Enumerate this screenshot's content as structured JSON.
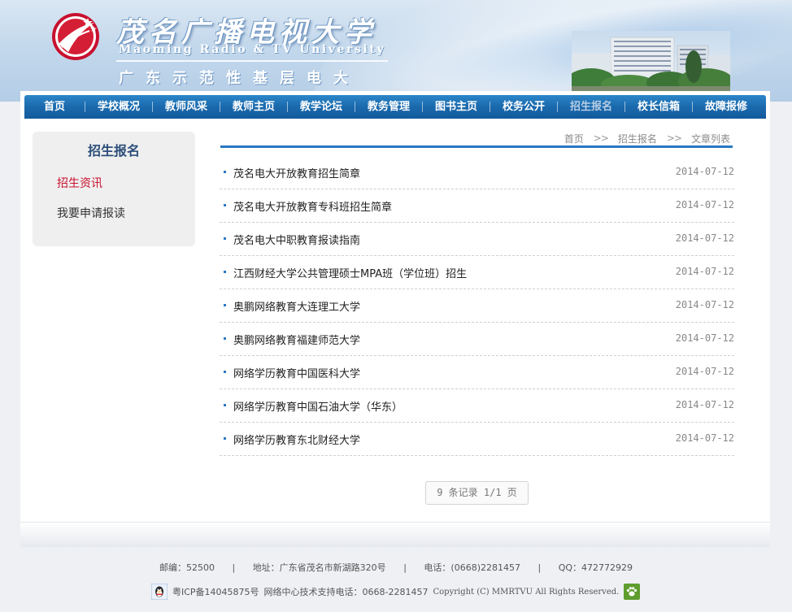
{
  "header": {
    "title_cn": "茂名广播电视大学",
    "title_en": "Maoming Radio & TV University",
    "slogan": "广东示范性基层电大"
  },
  "nav": {
    "items": [
      {
        "label": "首页",
        "width": 74
      },
      {
        "label": "学校概况",
        "width": 83
      },
      {
        "label": "教师风采",
        "width": 83
      },
      {
        "label": "教师主页",
        "width": 83
      },
      {
        "label": "教学论坛",
        "width": 83
      },
      {
        "label": "教务管理",
        "width": 83
      },
      {
        "label": "图书主页",
        "width": 83
      },
      {
        "label": "校务公开",
        "width": 83
      },
      {
        "label": "招生报名",
        "width": 83
      },
      {
        "label": "校长信箱",
        "width": 83
      },
      {
        "label": "故障报修",
        "width": 83
      }
    ],
    "active_index": 8
  },
  "sidebar": {
    "title": "招生报名",
    "links": [
      "招生资讯",
      "我要申请报读"
    ]
  },
  "breadcrumb": {
    "items": [
      "首页",
      "招生报名",
      "文章列表"
    ],
    "separator": ">>"
  },
  "articles": [
    {
      "title": "茂名电大开放教育招生简章",
      "date": "2014-07-12"
    },
    {
      "title": "茂名电大开放教育专科班招生简章",
      "date": "2014-07-12"
    },
    {
      "title": "茂名电大中职教育报读指南",
      "date": "2014-07-12"
    },
    {
      "title": "江西财经大学公共管理硕士MPA班（学位班）招生",
      "date": "2014-07-12"
    },
    {
      "title": "奥鹏网络教育大连理工大学",
      "date": "2014-07-12"
    },
    {
      "title": "奥鹏网络教育福建师范大学",
      "date": "2014-07-12"
    },
    {
      "title": "网络学历教育中国医科大学",
      "date": "2014-07-12"
    },
    {
      "title": "网络学历教育中国石油大学（华东）",
      "date": "2014-07-12"
    },
    {
      "title": "网络学历教育东北财经大学",
      "date": "2014-07-12"
    }
  ],
  "pagination": {
    "text": "9 条记录 1/1 页"
  },
  "footer": {
    "postcode": "邮编：52500",
    "address": "地址：广东省茂名市新湖路320号",
    "phone": "电话：(0668)2281457",
    "qq": "QQ：472772929",
    "icp": "粤ICP备14045875号",
    "support": "网络中心技术支持电话：0668-2281457",
    "copyright": "Copyright (C) MMRTVU All Rights Reserved."
  },
  "colors": {
    "nav_blue": "#1a69ad",
    "accent_red": "#c8102e",
    "rule_blue": "#2a78c4"
  }
}
